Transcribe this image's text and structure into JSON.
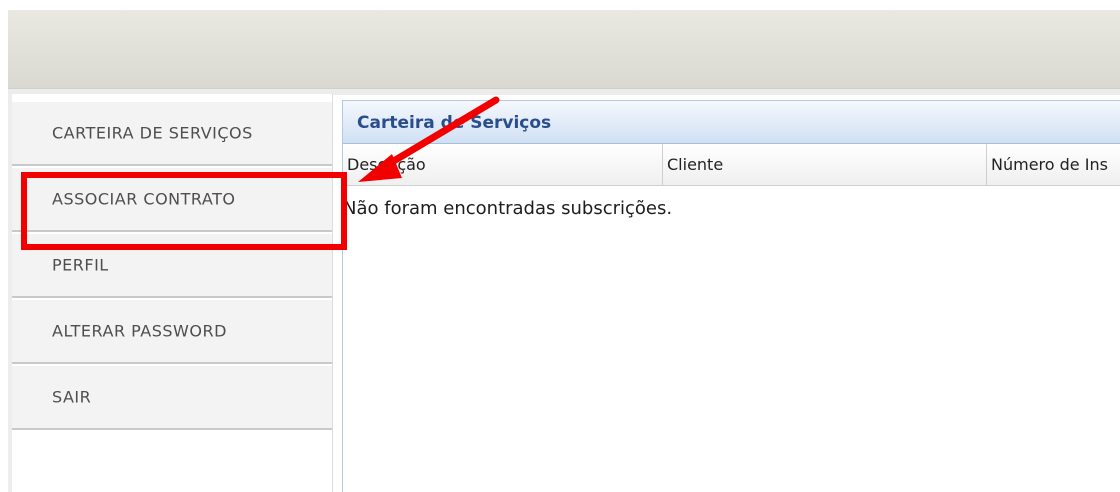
{
  "sidebar": {
    "items": [
      {
        "label": "CARTEIRA DE SERVIÇOS"
      },
      {
        "label": "ASSOCIAR CONTRATO"
      },
      {
        "label": "PERFIL"
      },
      {
        "label": "ALTERAR PASSWORD"
      },
      {
        "label": "SAIR"
      }
    ]
  },
  "panel": {
    "title": "Carteira de Serviços",
    "columns": [
      "Descrição",
      "Cliente",
      "Número de Ins"
    ],
    "empty_message": "Não foram encontradas subscrições."
  },
  "annotations": {
    "highlight_color": "#f20000",
    "arrow_icon": "red-arrow-icon"
  }
}
